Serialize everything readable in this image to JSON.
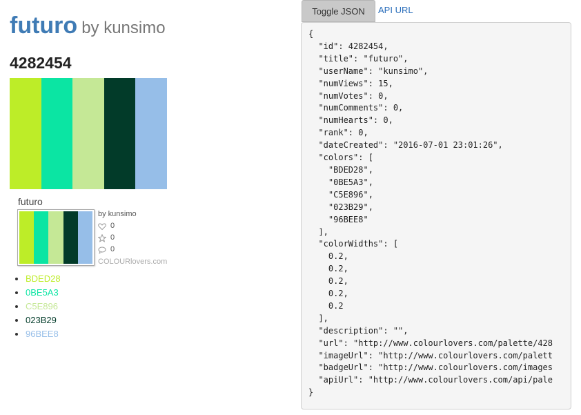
{
  "header": {
    "title": "futuro",
    "by": "by kunsimo"
  },
  "palette": {
    "id": "4282454",
    "colors": [
      "#BDED28",
      "#0BE5A3",
      "#C5E896",
      "#023B29",
      "#96BEE8"
    ],
    "widths": [
      0.2,
      0.2,
      0.2,
      0.2,
      0.2
    ]
  },
  "badge": {
    "title": "futuro",
    "by": "by kunsimo",
    "views": "0",
    "votes": "0",
    "comments": "0",
    "brand": "COLOURlovers.com"
  },
  "color_list": [
    {
      "label": "BDED28",
      "color": "#BDED28"
    },
    {
      "label": "0BE5A3",
      "color": "#0BE5A3"
    },
    {
      "label": "C5E896",
      "color": "#C5E896"
    },
    {
      "label": "023B29",
      "color": "#023B29"
    },
    {
      "label": "96BEE8",
      "color": "#96BEE8"
    }
  ],
  "toolbar": {
    "toggle_label": "Toggle JSON",
    "api_label": "API URL"
  },
  "json_text": "{\n  \"id\": 4282454,\n  \"title\": \"futuro\",\n  \"userName\": \"kunsimo\",\n  \"numViews\": 15,\n  \"numVotes\": 0,\n  \"numComments\": 0,\n  \"numHearts\": 0,\n  \"rank\": 0,\n  \"dateCreated\": \"2016-07-01 23:01:26\",\n  \"colors\": [\n    \"BDED28\",\n    \"0BE5A3\",\n    \"C5E896\",\n    \"023B29\",\n    \"96BEE8\"\n  ],\n  \"colorWidths\": [\n    0.2,\n    0.2,\n    0.2,\n    0.2,\n    0.2\n  ],\n  \"description\": \"\",\n  \"url\": \"http://www.colourlovers.com/palette/428\n  \"imageUrl\": \"http://www.colourlovers.com/palett\n  \"badgeUrl\": \"http://www.colourlovers.com/images\n  \"apiUrl\": \"http://www.colourlovers.com/api/pale\n}"
}
